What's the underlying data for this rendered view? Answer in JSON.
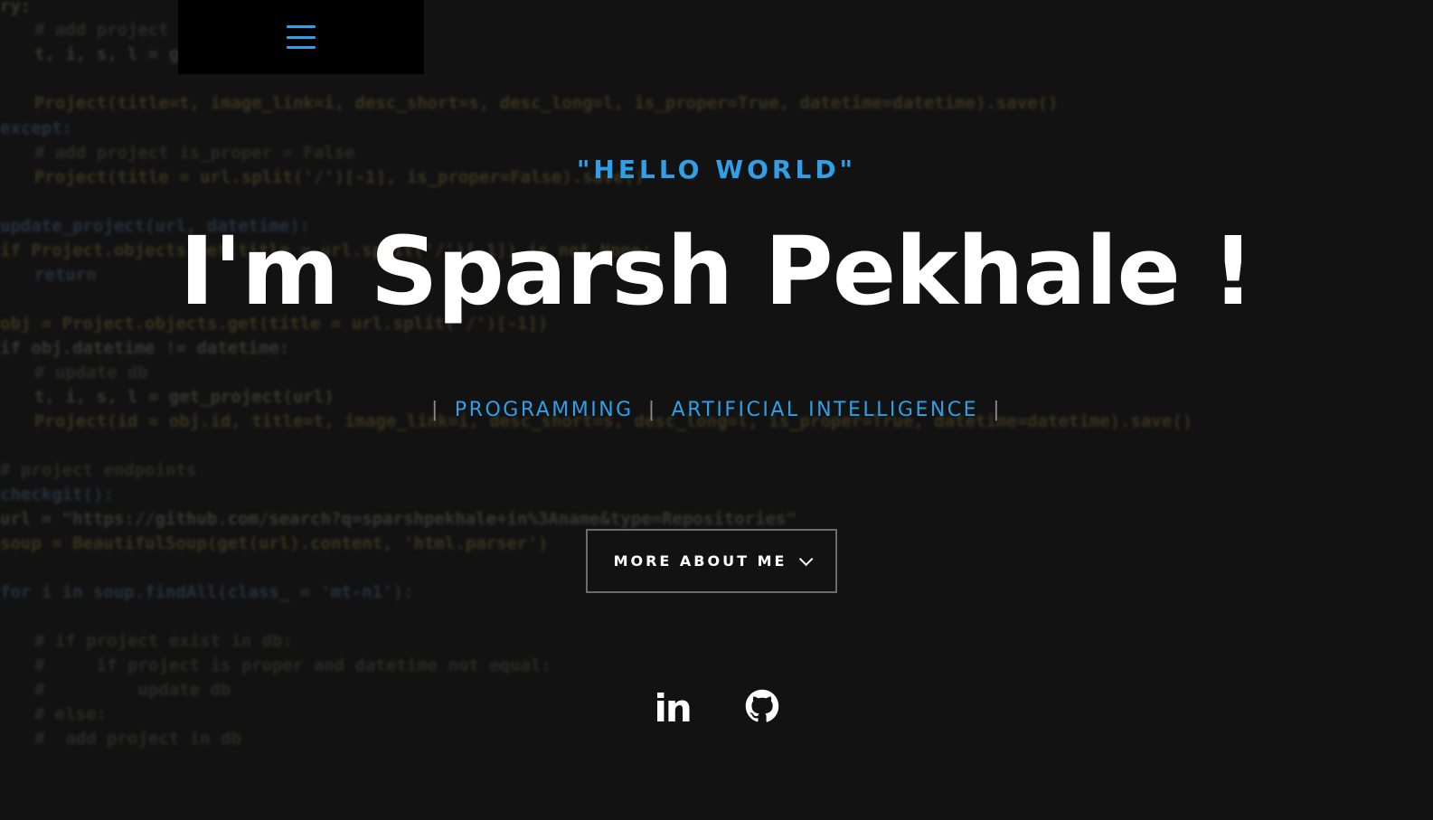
{
  "menu": {
    "icon": "hamburger-menu-icon"
  },
  "hero": {
    "greeting": "\"HELLO WORLD\"",
    "headline": "I'm Sparsh Pekhale !",
    "tags": {
      "sep": "|",
      "items": [
        "PROGRAMMING",
        "ARTIFICIAL INTELLIGENCE"
      ]
    },
    "button": {
      "label": "MORE ABOUT ME",
      "icon": "chevron-down-icon"
    }
  },
  "social": {
    "linkedin": {
      "icon": "linkedin-icon",
      "text": "in"
    },
    "github": {
      "icon": "github-icon"
    }
  },
  "colors": {
    "accent": "#2f9fe8",
    "background": "#121212",
    "text": "#ffffff"
  }
}
